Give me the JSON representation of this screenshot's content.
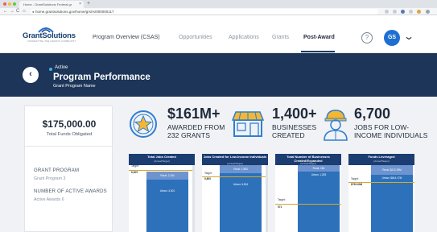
{
  "browser": {
    "tab_title": "Home - GrantSolutions Federal gr",
    "tab_close": "×",
    "new_tab": "+",
    "nav_back": "←",
    "nav_forward": "→",
    "nav_reload": "C",
    "nav_home": "⌂",
    "url": "home.grantsolutions.gov/home/grs/rs/000000117"
  },
  "header": {
    "logo_text": "GrantSolutions",
    "logo_sub": "CONNECTING THE GRANTS COMMUNITY",
    "nav": [
      {
        "label": "Program Overview (CSAS)"
      },
      {
        "label": "Opportunities"
      },
      {
        "label": "Applications"
      },
      {
        "label": "Grants"
      },
      {
        "label": "Post-Award"
      }
    ],
    "help": "?",
    "avatar": "GS",
    "menu_chevron": "⌄"
  },
  "banner": {
    "back": "‹",
    "status": "Active",
    "title": "Program Performance",
    "subtitle": "Grant Program Name"
  },
  "side": {
    "amount": "$175,000.00",
    "amount_label": "Total Funds Obligated",
    "program_label": "GRANT PROGRAM",
    "program_value": "Grant Program 3",
    "awards_label": "NUMBER OF ACTIVE AWARDS",
    "awards_value": "Active Awards 6"
  },
  "stats": [
    {
      "value": "$161M+",
      "line1": "AWARDED FROM",
      "line2": "232 GRANTS",
      "icon": "star-medal-icon"
    },
    {
      "value": "1,400+",
      "line1": "BUSINESSES",
      "line2": "CREATED",
      "icon": "storefront-icon"
    },
    {
      "value": "6,700",
      "line1": "JOBS FOR LOW-",
      "line2": "INCOME INDIVIDUALS",
      "icon": "worker-icon"
    }
  ],
  "colors": {
    "nav_dark": "#1c3558",
    "accent_blue": "#1f6fd1",
    "bar_rural": "#6d94cf",
    "bar_urban": "#2d71ba",
    "target": "#d8a82a",
    "icon_outline": "#2f7fd3",
    "icon_fill": "#f2b733"
  },
  "charts": [
    {
      "title": "Total Jobs Created",
      "sub": "(Actual/Target)",
      "target_label": "Target:",
      "target_value": "6,309",
      "rural_label": "Rural: 2,154",
      "urban_label": "Urban: 4,301"
    },
    {
      "title": "Jobs Created for Low-Income Individuals",
      "sub": "(Actual/Target)",
      "target_label": "Target:",
      "target_value": "5,800",
      "rural_label": "Rural: 1,984",
      "urban_label": "Urban: 5,816"
    },
    {
      "title": "Total Number of Businesses Created/Expanded",
      "sub": "(Actual/Target)",
      "target_label": "Target:",
      "target_value": "571",
      "rural_label": "Rural: 184",
      "urban_label": "Urban: 1,283"
    },
    {
      "title": "Funds Leveraged",
      "sub": "(Actual/Target)",
      "target_label": "Target:",
      "target_value": "$799.63M",
      "rural_label": "Rural: $213.39M",
      "urban_label": "Urban: $644.17M"
    }
  ]
}
